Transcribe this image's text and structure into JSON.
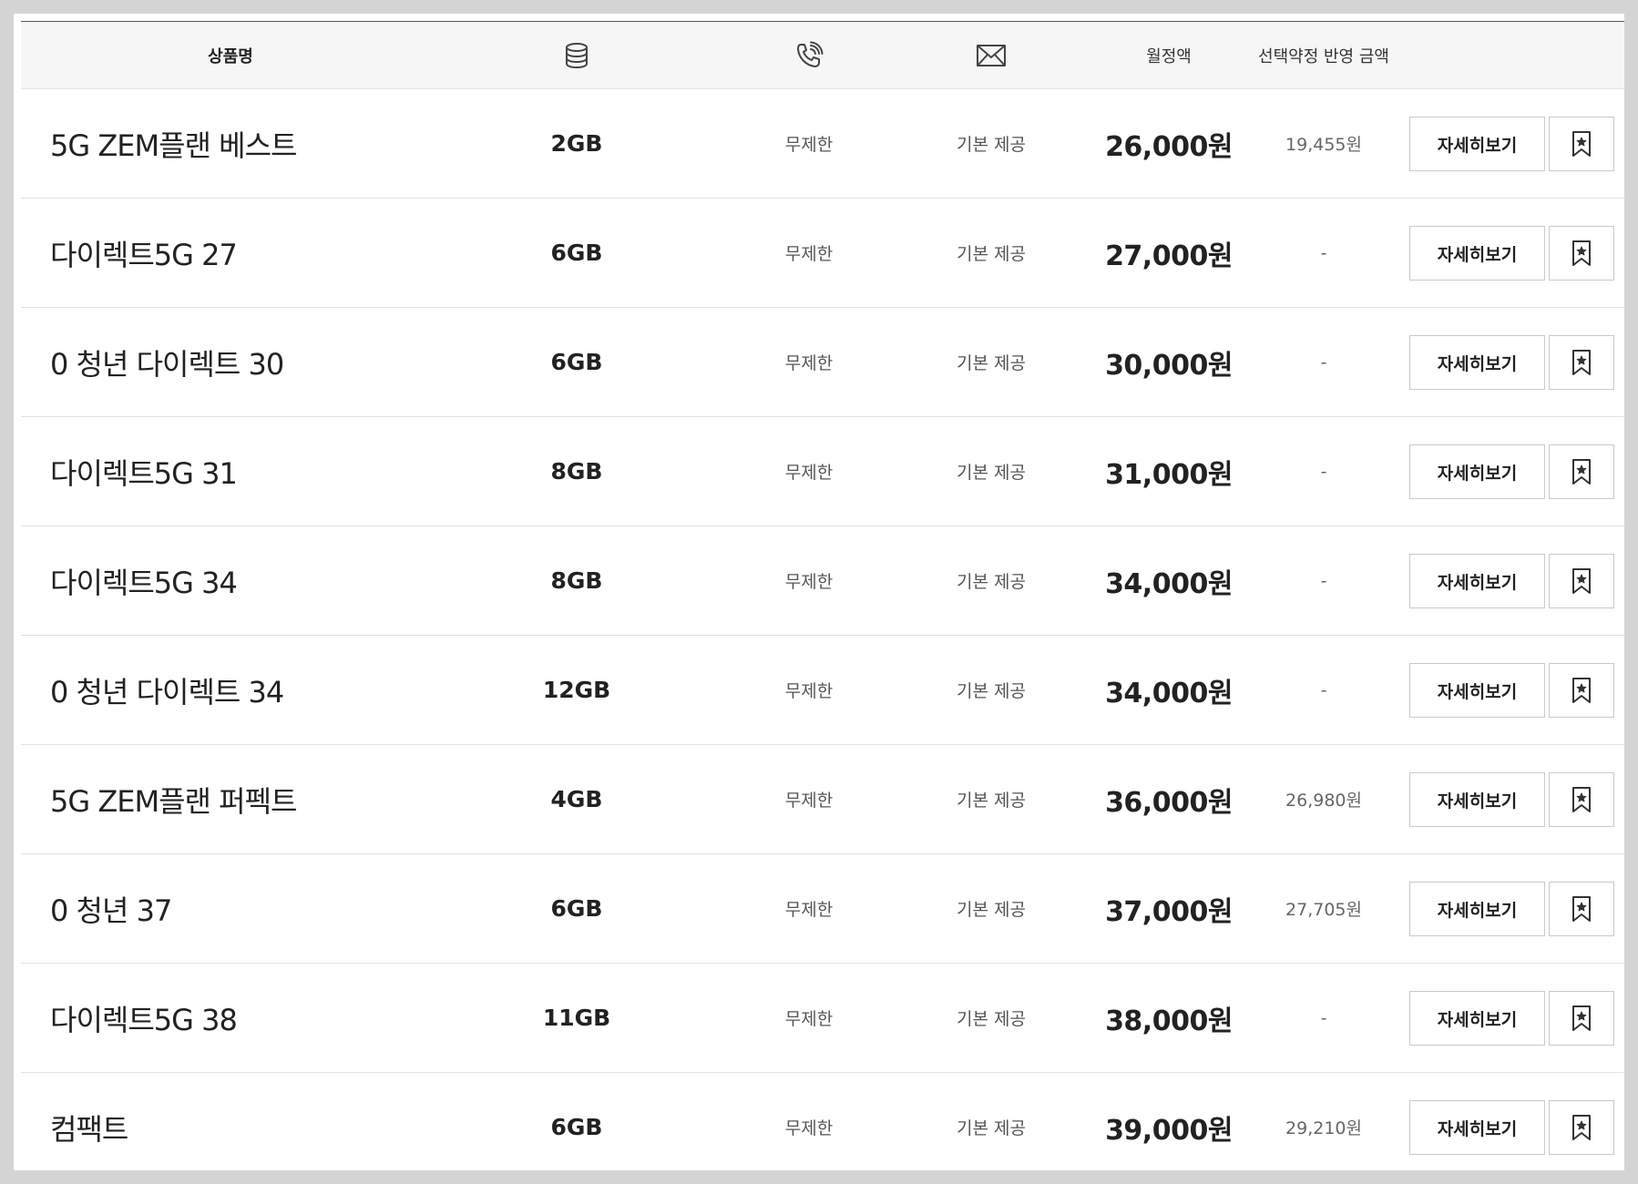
{
  "header": {
    "name": "상품명",
    "data_icon": "database-icon",
    "voice_icon": "phone-call-icon",
    "message_icon": "envelope-icon",
    "price": "월정액",
    "selective_price": "선택약정 반영 금액"
  },
  "buttons": {
    "detail_label": "자세히보기",
    "bookmark_icon": "bookmark-star-icon"
  },
  "rows": [
    {
      "name": "5G ZEM플랜 베스트",
      "data": "2GB",
      "voice": "무제한",
      "message": "기본 제공",
      "price": "26,000원",
      "selective_price": "19,455원"
    },
    {
      "name": "다이렉트5G 27",
      "data": "6GB",
      "voice": "무제한",
      "message": "기본 제공",
      "price": "27,000원",
      "selective_price": "-"
    },
    {
      "name": "0 청년 다이렉트 30",
      "data": "6GB",
      "voice": "무제한",
      "message": "기본 제공",
      "price": "30,000원",
      "selective_price": "-"
    },
    {
      "name": "다이렉트5G 31",
      "data": "8GB",
      "voice": "무제한",
      "message": "기본 제공",
      "price": "31,000원",
      "selective_price": "-"
    },
    {
      "name": "다이렉트5G 34",
      "data": "8GB",
      "voice": "무제한",
      "message": "기본 제공",
      "price": "34,000원",
      "selective_price": "-"
    },
    {
      "name": "0 청년 다이렉트 34",
      "data": "12GB",
      "voice": "무제한",
      "message": "기본 제공",
      "price": "34,000원",
      "selective_price": "-"
    },
    {
      "name": "5G ZEM플랜 퍼펙트",
      "data": "4GB",
      "voice": "무제한",
      "message": "기본 제공",
      "price": "36,000원",
      "selective_price": "26,980원"
    },
    {
      "name": "0 청년 37",
      "data": "6GB",
      "voice": "무제한",
      "message": "기본 제공",
      "price": "37,000원",
      "selective_price": "27,705원"
    },
    {
      "name": "다이렉트5G 38",
      "data": "11GB",
      "voice": "무제한",
      "message": "기본 제공",
      "price": "38,000원",
      "selective_price": "-"
    },
    {
      "name": "컴팩트",
      "data": "6GB",
      "voice": "무제한",
      "message": "기본 제공",
      "price": "39,000원",
      "selective_price": "29,210원"
    }
  ]
}
